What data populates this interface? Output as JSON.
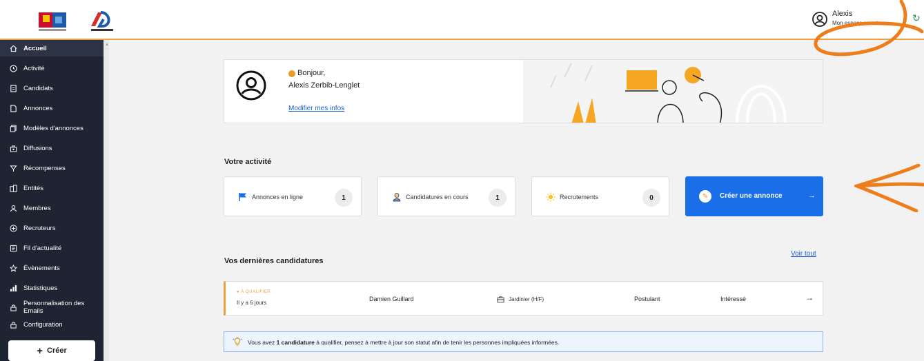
{
  "user": {
    "name": "Alexis",
    "space": "Mon espace recruteur"
  },
  "sidebar": {
    "items": [
      {
        "label": "Accueil",
        "icon": "home-icon",
        "active": true
      },
      {
        "label": "Activité",
        "icon": "activity-icon"
      },
      {
        "label": "Candidats",
        "icon": "candidates-icon"
      },
      {
        "label": "Annonces",
        "icon": "document-icon"
      },
      {
        "label": "Modèles d'annonces",
        "icon": "templates-icon"
      },
      {
        "label": "Diffusions",
        "icon": "broadcast-icon"
      },
      {
        "label": "Récompenses",
        "icon": "reward-icon"
      },
      {
        "label": "Entités",
        "icon": "building-icon"
      },
      {
        "label": "Membres",
        "icon": "person-icon"
      },
      {
        "label": "Recruteurs",
        "icon": "recruiter-icon"
      },
      {
        "label": "Fil d'actualité",
        "icon": "news-icon"
      },
      {
        "label": "Évènements",
        "icon": "star-icon"
      },
      {
        "label": "Statistiques",
        "icon": "chart-icon"
      },
      {
        "label": "Personnalisation des Emails",
        "icon": "lock-icon"
      },
      {
        "label": "Configuration",
        "icon": "lock-icon"
      }
    ],
    "create_label": "Créer"
  },
  "welcome": {
    "greeting": "Bonjour,",
    "fullname": "Alexis Zerbib-Lenglet",
    "edit_link": "Modifier mes infos"
  },
  "activity": {
    "title": "Votre activité",
    "cards": [
      {
        "label": "Annonces en ligne",
        "count": "1",
        "icon": "flag-icon"
      },
      {
        "label": "Candidatures en cours",
        "count": "1",
        "icon": "candidate-icon"
      },
      {
        "label": "Recrutements",
        "count": "0",
        "icon": "sun-icon"
      }
    ],
    "cta_label": "Créer une annonce",
    "cta_arrow": "→"
  },
  "recent": {
    "title": "Vos dernières candidatures",
    "see_all": "Voir tout",
    "rows": [
      {
        "status": "À QUALIFIER",
        "ago": "Il y a 6 jours",
        "name": "Damien Guillard",
        "job": "Jardinier (H/F)",
        "stage": "Postulant",
        "interest": "Intéressé",
        "arrow": "→"
      }
    ]
  },
  "info": {
    "prefix": "Vous avez ",
    "count": "1 candidature",
    "suffix": " à qualifier, pensez à mettre à jour son statut afin de tenir les personnes impliquées informées."
  },
  "colors": {
    "accent": "#1a6fe8",
    "sidebar": "#1e2431",
    "warning": "#f0a040",
    "annotation": "#ee7d1b"
  }
}
